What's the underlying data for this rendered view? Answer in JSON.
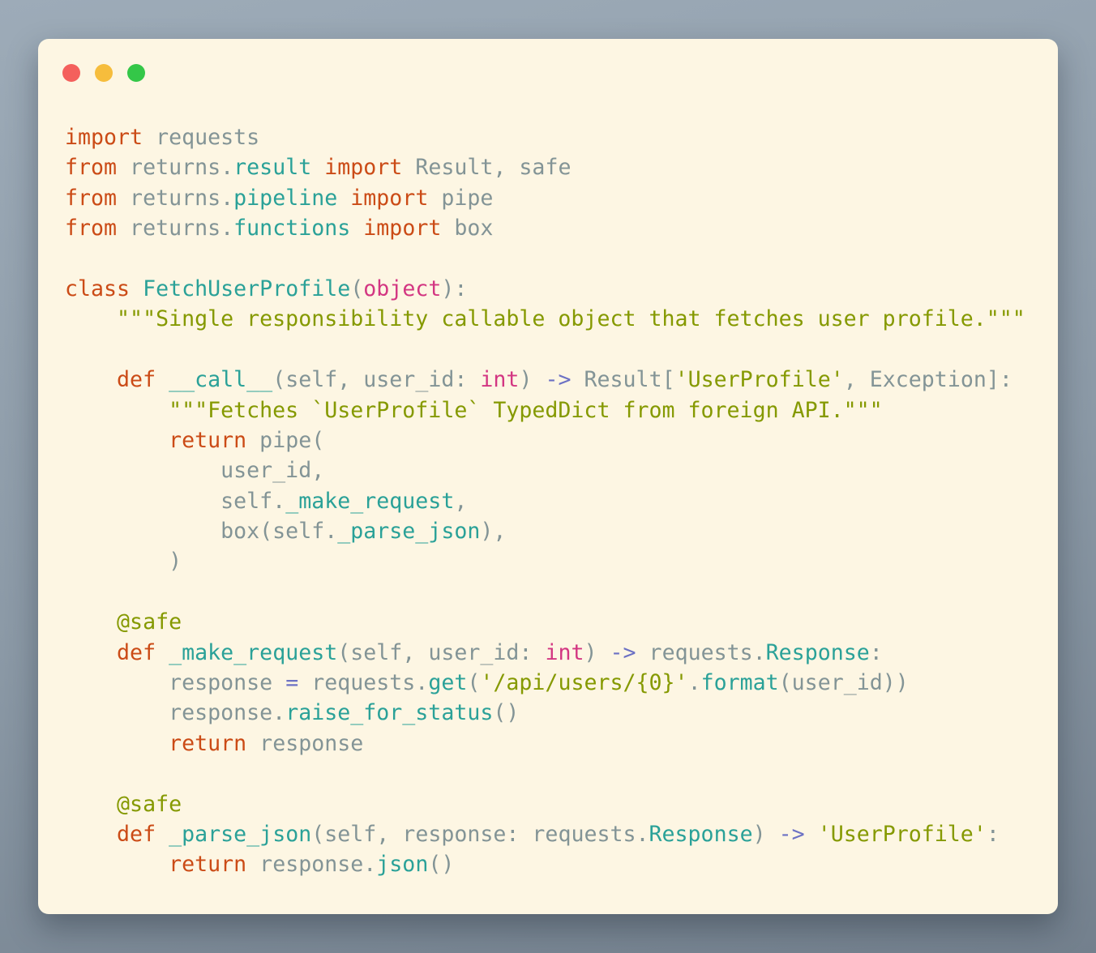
{
  "window": {
    "traffic_lights": [
      {
        "name": "close",
        "color": "#f4605c"
      },
      {
        "name": "minimize",
        "color": "#f6bd3c"
      },
      {
        "name": "maximize",
        "color": "#34c748"
      }
    ]
  },
  "theme": {
    "page_bg_top": "#9dabb8",
    "page_bg_bottom": "#73808d",
    "card_bg": "#fdf6e3",
    "token_colors": {
      "k": "#cb4b16",
      "n": "#2aa198",
      "b": "#d33682",
      "s": "#859900",
      "o": "#6c71c4",
      "t": "#839496"
    }
  },
  "code": {
    "lines": [
      [
        [
          "k",
          "import"
        ],
        [
          "t",
          " requests"
        ]
      ],
      [
        [
          "k",
          "from"
        ],
        [
          "t",
          " returns."
        ],
        [
          "n",
          "result"
        ],
        [
          "t",
          " "
        ],
        [
          "k",
          "import"
        ],
        [
          "t",
          " Result, safe"
        ]
      ],
      [
        [
          "k",
          "from"
        ],
        [
          "t",
          " returns."
        ],
        [
          "n",
          "pipeline"
        ],
        [
          "t",
          " "
        ],
        [
          "k",
          "import"
        ],
        [
          "t",
          " pipe"
        ]
      ],
      [
        [
          "k",
          "from"
        ],
        [
          "t",
          " returns."
        ],
        [
          "n",
          "functions"
        ],
        [
          "t",
          " "
        ],
        [
          "k",
          "import"
        ],
        [
          "t",
          " box"
        ]
      ],
      [],
      [
        [
          "k",
          "class"
        ],
        [
          "t",
          " "
        ],
        [
          "n",
          "FetchUserProfile"
        ],
        [
          "t",
          "("
        ],
        [
          "b",
          "object"
        ],
        [
          "t",
          "):"
        ]
      ],
      [
        [
          "s",
          "    \"\"\"Single responsibility callable object that fetches user profile.\"\"\""
        ]
      ],
      [],
      [
        [
          "t",
          "    "
        ],
        [
          "k",
          "def"
        ],
        [
          "t",
          " "
        ],
        [
          "n",
          "__call__"
        ],
        [
          "t",
          "(self, user_id: "
        ],
        [
          "b",
          "int"
        ],
        [
          "t",
          ") "
        ],
        [
          "o",
          "->"
        ],
        [
          "t",
          " Result["
        ],
        [
          "s",
          "'UserProfile'"
        ],
        [
          "t",
          ", Exception]:"
        ]
      ],
      [
        [
          "s",
          "        \"\"\"Fetches `UserProfile` TypedDict from foreign API.\"\"\""
        ]
      ],
      [
        [
          "t",
          "        "
        ],
        [
          "k",
          "return"
        ],
        [
          "t",
          " pipe("
        ]
      ],
      [
        [
          "t",
          "            user_id,"
        ]
      ],
      [
        [
          "t",
          "            self."
        ],
        [
          "n",
          "_make_request"
        ],
        [
          "t",
          ","
        ]
      ],
      [
        [
          "t",
          "            box(self."
        ],
        [
          "n",
          "_parse_json"
        ],
        [
          "t",
          "),"
        ]
      ],
      [
        [
          "t",
          "        )"
        ]
      ],
      [],
      [
        [
          "t",
          "    "
        ],
        [
          "s",
          "@safe"
        ]
      ],
      [
        [
          "t",
          "    "
        ],
        [
          "k",
          "def"
        ],
        [
          "t",
          " "
        ],
        [
          "n",
          "_make_request"
        ],
        [
          "t",
          "(self, user_id: "
        ],
        [
          "b",
          "int"
        ],
        [
          "t",
          ") "
        ],
        [
          "o",
          "->"
        ],
        [
          "t",
          " requests."
        ],
        [
          "n",
          "Response"
        ],
        [
          "t",
          ":"
        ]
      ],
      [
        [
          "t",
          "        response "
        ],
        [
          "o",
          "="
        ],
        [
          "t",
          " requests."
        ],
        [
          "n",
          "get"
        ],
        [
          "t",
          "("
        ],
        [
          "s",
          "'/api/users/{0}'"
        ],
        [
          "t",
          "."
        ],
        [
          "n",
          "format"
        ],
        [
          "t",
          "(user_id))"
        ]
      ],
      [
        [
          "t",
          "        response."
        ],
        [
          "n",
          "raise_for_status"
        ],
        [
          "t",
          "()"
        ]
      ],
      [
        [
          "t",
          "        "
        ],
        [
          "k",
          "return"
        ],
        [
          "t",
          " response"
        ]
      ],
      [],
      [
        [
          "t",
          "    "
        ],
        [
          "s",
          "@safe"
        ]
      ],
      [
        [
          "t",
          "    "
        ],
        [
          "k",
          "def"
        ],
        [
          "t",
          " "
        ],
        [
          "n",
          "_parse_json"
        ],
        [
          "t",
          "(self, response: requests."
        ],
        [
          "n",
          "Response"
        ],
        [
          "t",
          ") "
        ],
        [
          "o",
          "->"
        ],
        [
          "t",
          " "
        ],
        [
          "s",
          "'UserProfile'"
        ],
        [
          "t",
          ":"
        ]
      ],
      [
        [
          "t",
          "        "
        ],
        [
          "k",
          "return"
        ],
        [
          "t",
          " response."
        ],
        [
          "n",
          "json"
        ],
        [
          "t",
          "()"
        ]
      ]
    ]
  }
}
